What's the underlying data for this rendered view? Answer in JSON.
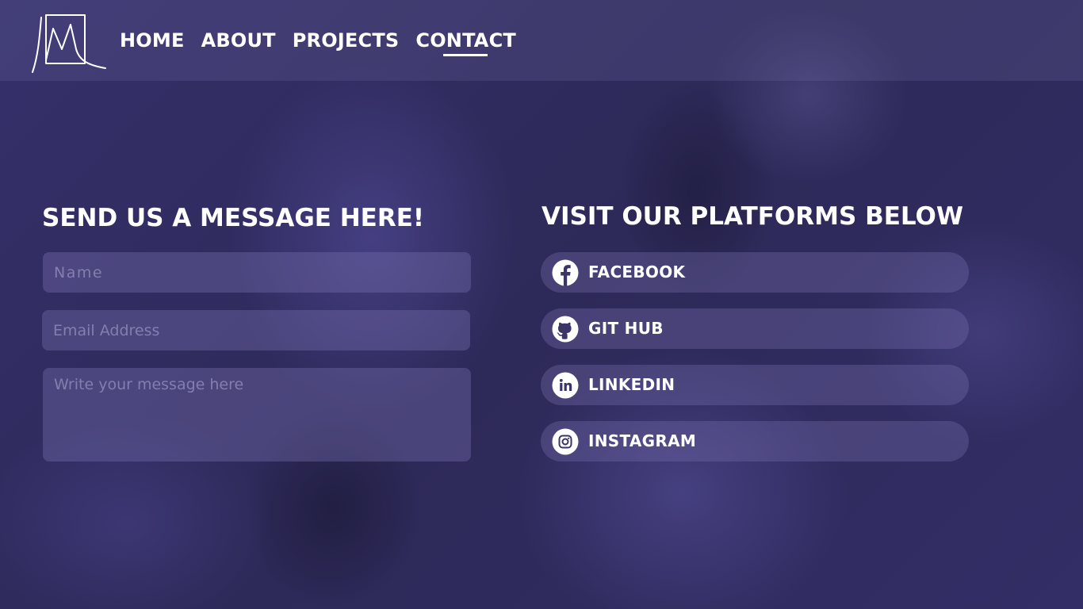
{
  "nav": {
    "items": [
      {
        "label": "HOME"
      },
      {
        "label": "ABOUT"
      },
      {
        "label": "PROJECTS"
      },
      {
        "label": "CONTACT",
        "active": true
      }
    ]
  },
  "form": {
    "heading": "SEND US A MESSAGE HERE!",
    "name_placeholder": "Name",
    "email_placeholder": "Email Address",
    "message_placeholder": "Write your message here"
  },
  "platforms": {
    "heading": "VISIT OUR PLATFORMS BELOW",
    "items": [
      {
        "label": "FACEBOOK",
        "icon": "facebook-icon"
      },
      {
        "label": "GIT HUB",
        "icon": "github-icon"
      },
      {
        "label": "LINKEDIN",
        "icon": "linkedin-icon"
      },
      {
        "label": "INSTAGRAM",
        "icon": "instagram-icon"
      }
    ]
  },
  "colors": {
    "background": "#2e2a55",
    "text": "#ffffff"
  }
}
